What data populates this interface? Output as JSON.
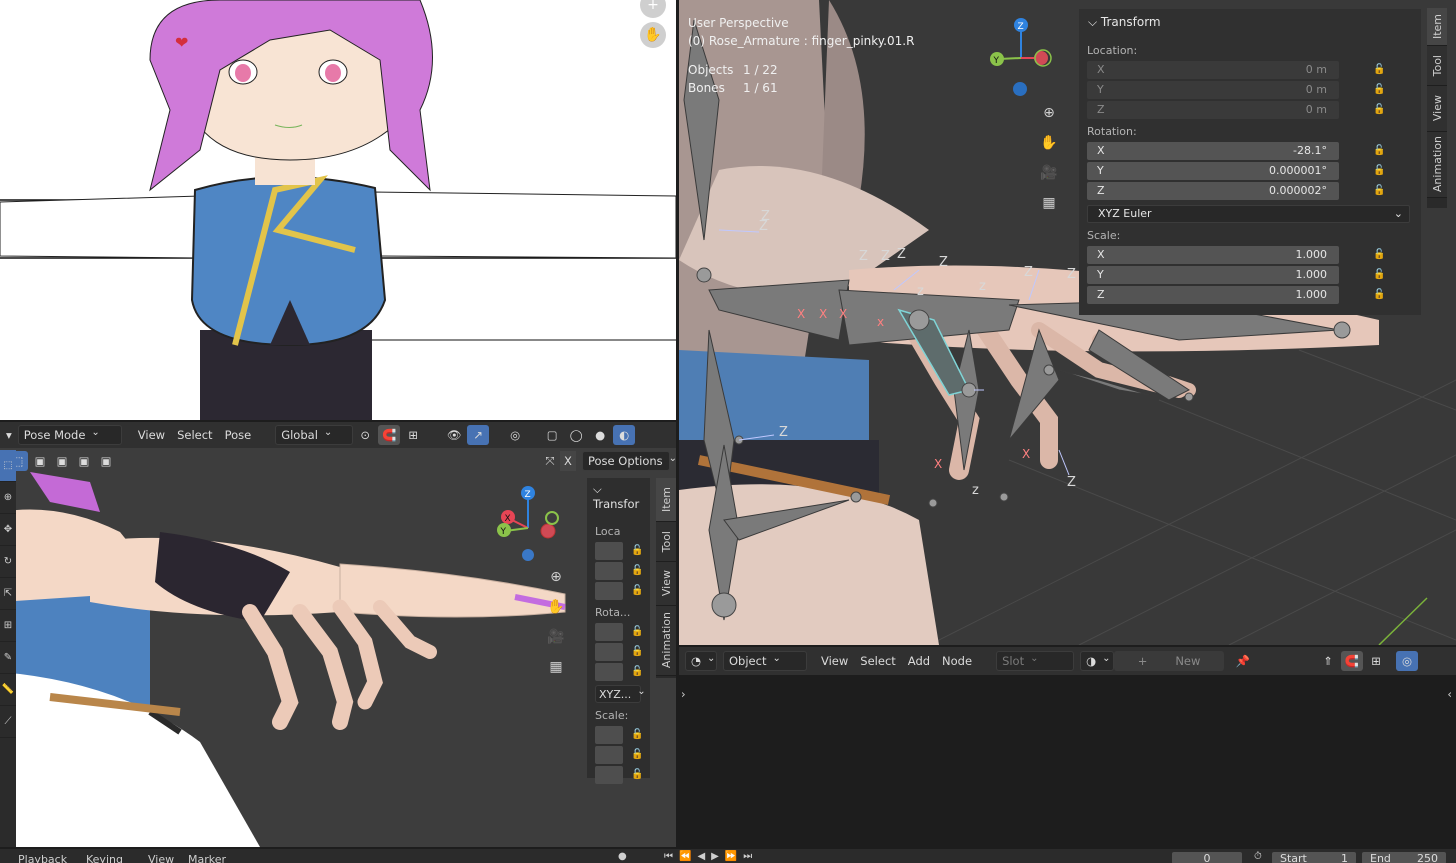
{
  "left_viewport": {
    "header": {
      "mode": "Pose Mode",
      "menus": [
        "View",
        "Select",
        "Pose"
      ],
      "orientation": "Global",
      "pose_options": "Pose Options",
      "x_label": "X"
    },
    "tabs": [
      "Item",
      "Tool",
      "View",
      "Animation"
    ],
    "npanel": {
      "title": "Transfor",
      "location": "Loca",
      "rotation": "Rota...",
      "rotation_mode": "XYZ...",
      "scale": "Scale:"
    }
  },
  "right_viewport": {
    "overlay": {
      "perspective": "User Perspective",
      "context": "(0) Rose_Armature : finger_pinky.01.R",
      "objects_label": "Objects",
      "objects_value": "1 / 22",
      "bones_label": "Bones",
      "bones_value": "1 / 61"
    },
    "tabs": [
      "Item",
      "Tool",
      "View",
      "Animation"
    ],
    "transform": {
      "title": "Transform",
      "location_label": "Location:",
      "location": [
        {
          "axis": "X",
          "value": "0 m"
        },
        {
          "axis": "Y",
          "value": "0 m"
        },
        {
          "axis": "Z",
          "value": "0 m"
        }
      ],
      "rotation_label": "Rotation:",
      "rotation": [
        {
          "axis": "X",
          "value": "-28.1°"
        },
        {
          "axis": "Y",
          "value": "0.000001°"
        },
        {
          "axis": "Z",
          "value": "0.000002°"
        }
      ],
      "rotation_mode": "XYZ Euler",
      "scale_label": "Scale:",
      "scale": [
        {
          "axis": "X",
          "value": "1.000"
        },
        {
          "axis": "Y",
          "value": "1.000"
        },
        {
          "axis": "Z",
          "value": "1.000"
        }
      ]
    }
  },
  "shader_editor": {
    "header": {
      "object": "Object",
      "menus": [
        "View",
        "Select",
        "Add",
        "Node"
      ],
      "slot": "Slot",
      "new_button": "New"
    }
  },
  "timeline": {
    "menus": [
      "Playback",
      "Keying",
      "View",
      "Marker"
    ],
    "frame": "0",
    "start_label": "Start",
    "start_value": "1",
    "end_label": "End",
    "end_value": "250"
  },
  "colors": {
    "accent": "#4772b3",
    "gizmo_x": "#e64555",
    "gizmo_y": "#8bc34a",
    "gizmo_z": "#2f83e0",
    "bone": "#6e6e6e",
    "bone_selected": "#7fd4d6"
  }
}
